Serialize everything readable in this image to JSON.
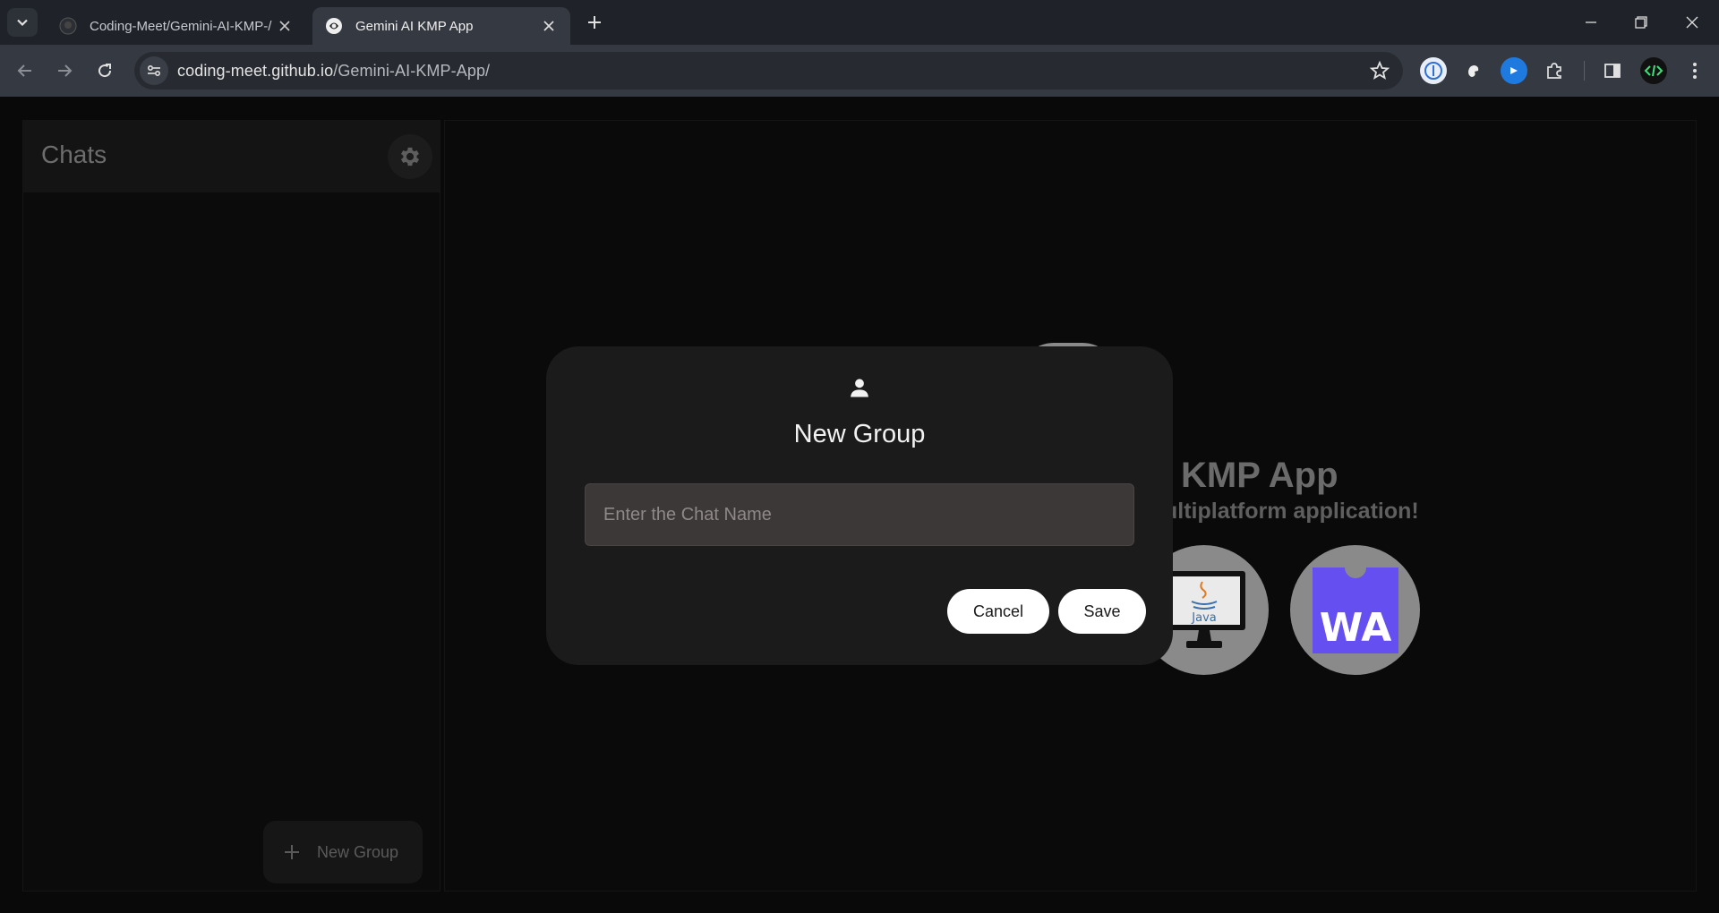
{
  "browser": {
    "tabs": [
      {
        "title": "Coding-Meet/Gemini-AI-KMP-/",
        "active": false
      },
      {
        "title": "Gemini AI KMP App",
        "active": true
      }
    ],
    "url": {
      "host": "coding-meet.github.io",
      "path": "/Gemini-AI-KMP-App/"
    }
  },
  "sidebar": {
    "title": "Chats",
    "new_group_label": "New Group"
  },
  "main": {
    "title": "KMP App",
    "subtitle": "ultiplatform application!",
    "platforms": [
      {
        "name": "desktop-java-icon",
        "label": "Java"
      },
      {
        "name": "webassembly-icon",
        "label": "WA"
      }
    ]
  },
  "dialog": {
    "title": "New Group",
    "input_placeholder": "Enter the Chat Name",
    "input_value": "",
    "cancel_label": "Cancel",
    "save_label": "Save"
  },
  "colors": {
    "accent_wasm": "#654ff0",
    "dialog_bg": "#1b1b1b",
    "page_bg": "#0a0a0a"
  }
}
